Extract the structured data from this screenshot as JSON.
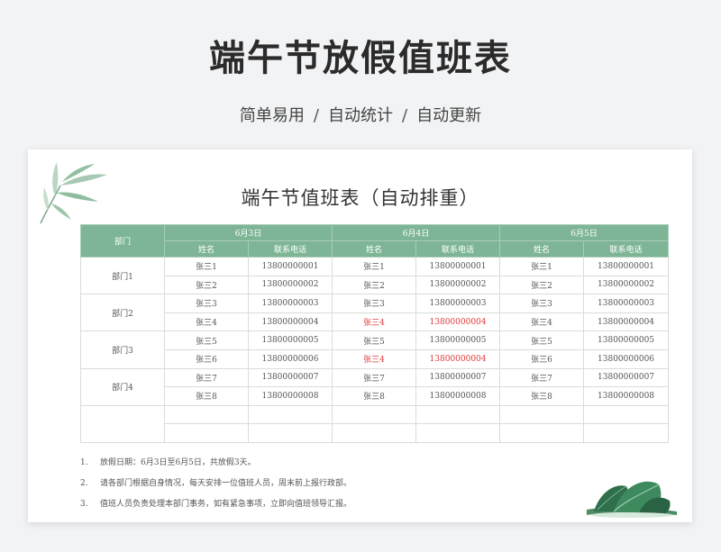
{
  "header": {
    "title": "端午节放假值班表",
    "tags": [
      "简单易用",
      "自动统计",
      "自动更新"
    ],
    "separator": "/"
  },
  "sheet": {
    "title": "端午节值班表（自动排重）",
    "dept_header": "部门",
    "dates": [
      "6月3日",
      "6月4日",
      "6月5日"
    ],
    "col_name": "姓名",
    "col_phone": "联系电话",
    "departments": [
      "部门1",
      "部门2",
      "部门3",
      "部门4"
    ],
    "rows": [
      [
        {
          "name": "张三1",
          "phone": "13800000001"
        },
        {
          "name": "张三1",
          "phone": "13800000001"
        },
        {
          "name": "张三1",
          "phone": "13800000001"
        }
      ],
      [
        {
          "name": "张三2",
          "phone": "13800000002"
        },
        {
          "name": "张三2",
          "phone": "13800000002"
        },
        {
          "name": "张三2",
          "phone": "13800000002"
        }
      ],
      [
        {
          "name": "张三3",
          "phone": "13800000003"
        },
        {
          "name": "张三3",
          "phone": "13800000003"
        },
        {
          "name": "张三3",
          "phone": "13800000003"
        }
      ],
      [
        {
          "name": "张三4",
          "phone": "13800000004"
        },
        {
          "name": "张三4",
          "phone": "13800000004",
          "dup": true
        },
        {
          "name": "张三4",
          "phone": "13800000004"
        }
      ],
      [
        {
          "name": "张三5",
          "phone": "13800000005"
        },
        {
          "name": "张三5",
          "phone": "13800000005"
        },
        {
          "name": "张三5",
          "phone": "13800000005"
        }
      ],
      [
        {
          "name": "张三6",
          "phone": "13800000006"
        },
        {
          "name": "张三4",
          "phone": "13800000004",
          "dup": true
        },
        {
          "name": "张三6",
          "phone": "13800000006"
        }
      ],
      [
        {
          "name": "张三7",
          "phone": "13800000007"
        },
        {
          "name": "张三7",
          "phone": "13800000007"
        },
        {
          "name": "张三7",
          "phone": "13800000007"
        }
      ],
      [
        {
          "name": "张三8",
          "phone": "13800000008"
        },
        {
          "name": "张三8",
          "phone": "13800000008"
        },
        {
          "name": "张三8",
          "phone": "13800000008"
        }
      ]
    ],
    "duplicate_color": "#e03a3a",
    "header_color": "#7db596",
    "notes": [
      {
        "num": "1.",
        "text": "放假日期：6月3日至6月5日，共放假3天。"
      },
      {
        "num": "2.",
        "text": "请各部门根据自身情况，每天安排一位值班人员，周末前上报行政部。"
      },
      {
        "num": "3.",
        "text": "值班人员负责处理本部门事务，如有紧急事项，立即向值班领导汇报。"
      }
    ]
  },
  "decor": {
    "top_left": "bamboo-leaf-icon",
    "bottom_right": "zongzi-icon"
  }
}
